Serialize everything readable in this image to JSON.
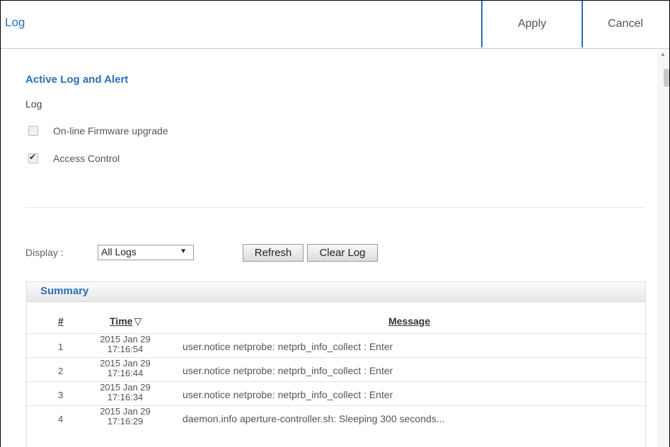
{
  "header": {
    "title": "Log",
    "apply_label": "Apply",
    "cancel_label": "Cancel"
  },
  "section": {
    "title": "Active Log and Alert",
    "subtitle": "Log",
    "checkboxes": [
      {
        "label": "On-line Firmware upgrade",
        "checked": false
      },
      {
        "label": "Access Control",
        "checked": true
      }
    ]
  },
  "controls": {
    "display_label": "Display :",
    "display_value": "All Logs",
    "refresh_label": "Refresh",
    "clear_label": "Clear Log"
  },
  "summary": {
    "title": "Summary",
    "columns": {
      "num": "#",
      "time": "Time",
      "message": "Message"
    },
    "rows": [
      {
        "num": "1",
        "date": "2015 Jan 29",
        "time": "17:16:54",
        "message": "user.notice netprobe: netprb_info_collect : Enter"
      },
      {
        "num": "2",
        "date": "2015 Jan 29",
        "time": "17:16:44",
        "message": "user.notice netprobe: netprb_info_collect : Enter"
      },
      {
        "num": "3",
        "date": "2015 Jan 29",
        "time": "17:16:34",
        "message": "user.notice netprobe: netprb_info_collect : Enter"
      },
      {
        "num": "4",
        "date": "2015 Jan 29",
        "time": "17:16:29",
        "message": "daemon.info aperture-controller.sh: Sleeping 300 seconds..."
      }
    ]
  }
}
